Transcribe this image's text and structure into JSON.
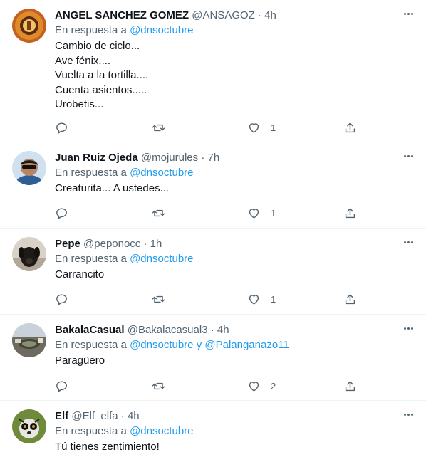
{
  "tweets": [
    {
      "name": "ANGEL SANCHEZ GOMEZ",
      "handle": "@ANSAGOZ",
      "separator": "·",
      "time": "4h",
      "reply_prefix": "En respuesta a",
      "mentions": [
        "@dnsoctubre"
      ],
      "mention_joiner": "",
      "lines": [
        "Cambio de ciclo...",
        "Ave fénix....",
        "Vuelta a la tortilla....",
        "Cuenta asientos.....",
        "Urobetis..."
      ],
      "likes": "1"
    },
    {
      "name": "Juan Ruiz Ojeda",
      "handle": "@mojurules",
      "separator": "·",
      "time": "7h",
      "reply_prefix": "En respuesta a",
      "mentions": [
        "@dnsoctubre"
      ],
      "mention_joiner": "",
      "lines": [
        "Creaturita... A ustedes..."
      ],
      "likes": "1"
    },
    {
      "name": "Pepe",
      "handle": "@peponocc",
      "separator": "·",
      "time": "1h",
      "reply_prefix": "En respuesta a",
      "mentions": [
        "@dnsoctubre"
      ],
      "mention_joiner": "",
      "lines": [
        "Carrancito"
      ],
      "likes": "1"
    },
    {
      "name": "BakalaCasual",
      "handle": "@Bakalacasual3",
      "separator": "·",
      "time": "4h",
      "reply_prefix": "En respuesta a",
      "mentions": [
        "@dnsoctubre",
        "@Palanganazo11"
      ],
      "mention_joiner": "y",
      "lines": [
        "Paragüero"
      ],
      "likes": "2"
    },
    {
      "name": "Elf",
      "handle": "@Elf_elfa",
      "separator": "·",
      "time": "4h",
      "reply_prefix": "En respuesta a",
      "mentions": [
        "@dnsoctubre"
      ],
      "mention_joiner": "",
      "lines": [
        "Tú tienes zentimiento!"
      ],
      "likes": ""
    }
  ],
  "icons": {
    "reply": "reply-icon",
    "retweet": "retweet-icon",
    "like": "like-icon",
    "share": "share-icon",
    "more": "more-icon"
  },
  "colors": {
    "text": "#0f1419",
    "muted": "#536471",
    "link": "#1d9bf0",
    "divider": "#eff3f4"
  }
}
